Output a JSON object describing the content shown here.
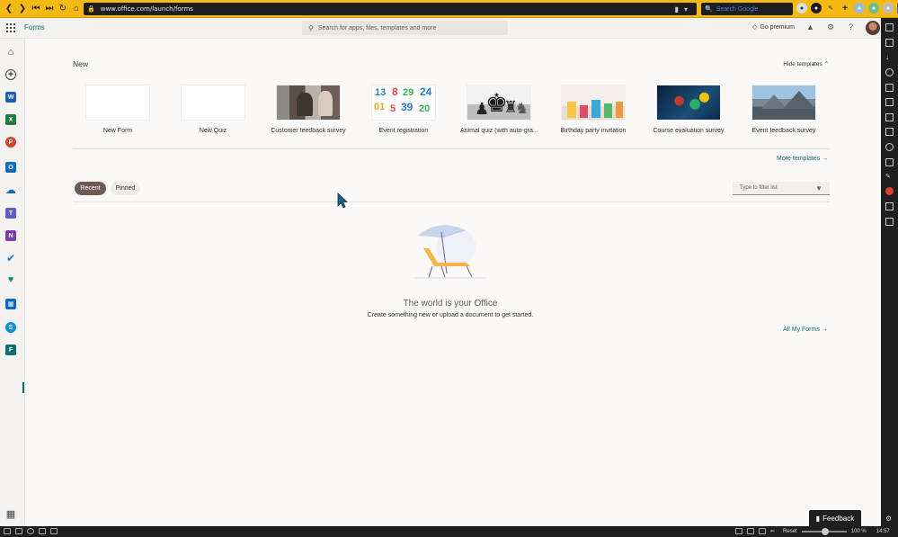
{
  "browser": {
    "url": "www.office.com/launch/forms",
    "search_placeholder": "Search Google",
    "nav_icons": [
      "back-icon",
      "forward-icon",
      "rewind-icon",
      "fast-forward-icon",
      "reload-icon",
      "home-icon"
    ]
  },
  "header": {
    "app_name": "Forms",
    "search_placeholder": "Search for apps, files, templates and more",
    "go_premium": "Go premium"
  },
  "new_section": {
    "title": "New",
    "hide_templates": "Hide templates ⌃",
    "templates": [
      {
        "label": "New Form"
      },
      {
        "label": "New Quiz"
      },
      {
        "label": "Customer feedback survey"
      },
      {
        "label": "Event registration"
      },
      {
        "label": "Animal quiz (with auto-gra..."
      },
      {
        "label": "Birthday party invitation"
      },
      {
        "label": "Course evaluation survey"
      },
      {
        "label": "Event feedback survey"
      }
    ],
    "more_templates": "More templates →"
  },
  "filters": {
    "recent": "Recent",
    "pinned": "Pinned",
    "filter_placeholder": "Type to filter list"
  },
  "empty_state": {
    "title": "The world is your Office",
    "subtitle": "Create something new or upload a document to get started.",
    "all_forms": "All My Forms →"
  },
  "feedback": {
    "label": "Feedback"
  },
  "status_bar": {
    "zoom": "100 %",
    "reset": "Reset",
    "time": "14:57"
  },
  "colors": {
    "accent": "#0f6e6e",
    "browser_bar": "#f5b914",
    "recent_pill": "#6e5a54"
  }
}
